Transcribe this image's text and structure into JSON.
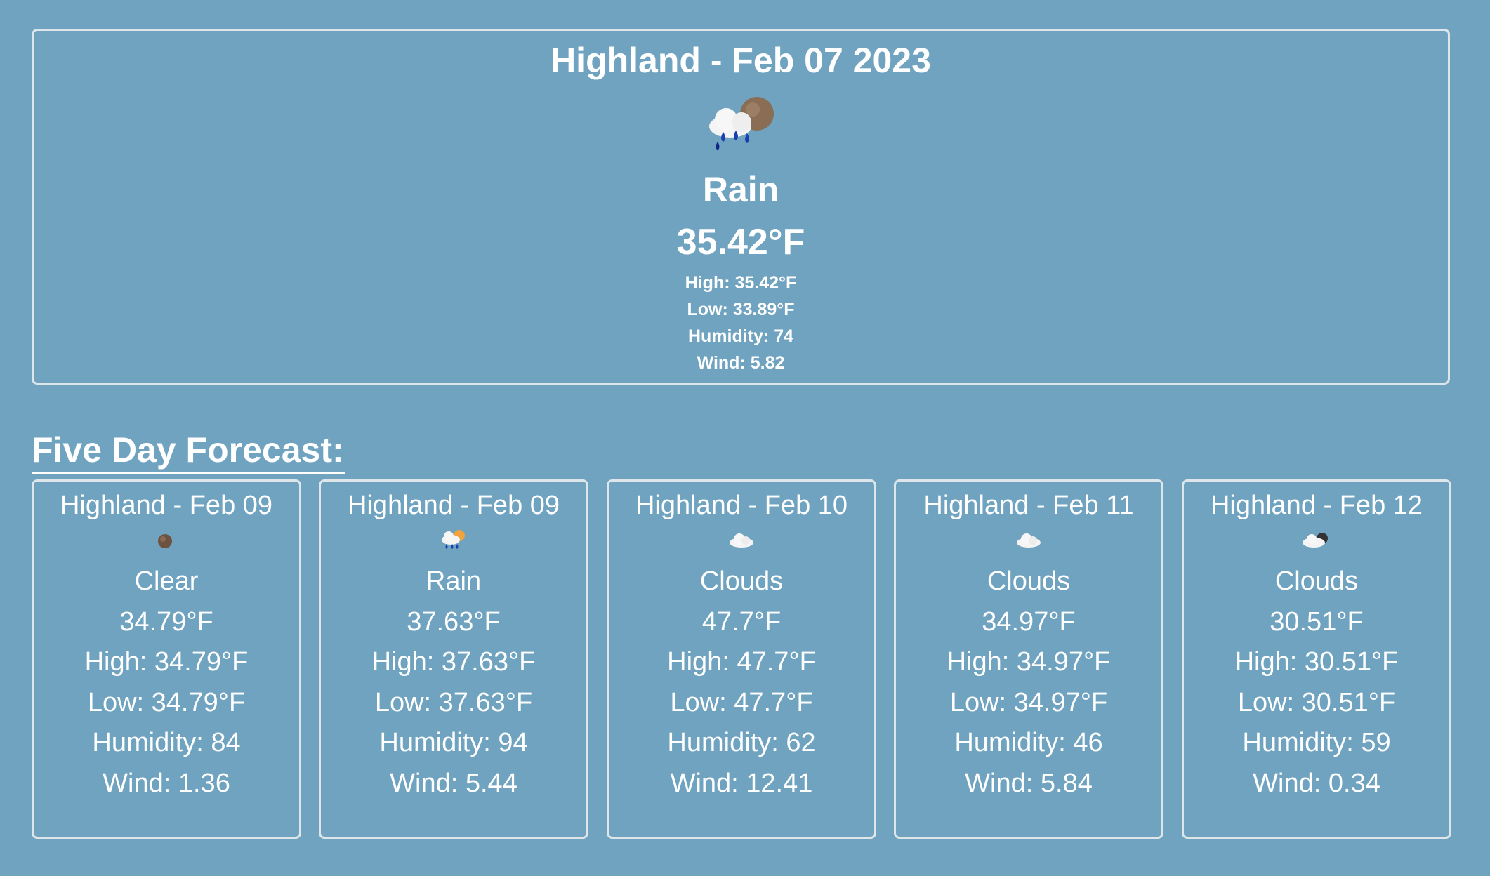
{
  "current": {
    "title": "Highland - Feb 07 2023",
    "icon": "rain-sun-icon",
    "condition": "Rain",
    "temp": "35.42°F",
    "high": "High: 35.42°F",
    "low": "Low: 33.89°F",
    "humidity": "Humidity: 74",
    "wind": "Wind: 5.82"
  },
  "forecast": {
    "heading": "Five Day Forecast:",
    "days": [
      {
        "title": "Highland - Feb 09",
        "icon": "clear-night-icon",
        "condition": "Clear",
        "temp": "34.79°F",
        "high": "High: 34.79°F",
        "low": "Low: 34.79°F",
        "humidity": "Humidity: 84",
        "wind": "Wind: 1.36"
      },
      {
        "title": "Highland - Feb 09",
        "icon": "rain-sun-icon",
        "condition": "Rain",
        "temp": "37.63°F",
        "high": "High: 37.63°F",
        "low": "Low: 37.63°F",
        "humidity": "Humidity: 94",
        "wind": "Wind: 5.44"
      },
      {
        "title": "Highland - Feb 10",
        "icon": "cloud-icon",
        "condition": "Clouds",
        "temp": "47.7°F",
        "high": "High: 47.7°F",
        "low": "Low: 47.7°F",
        "humidity": "Humidity: 62",
        "wind": "Wind: 12.41"
      },
      {
        "title": "Highland - Feb 11",
        "icon": "cloud-icon",
        "condition": "Clouds",
        "temp": "34.97°F",
        "high": "High: 34.97°F",
        "low": "Low: 34.97°F",
        "humidity": "Humidity: 46",
        "wind": "Wind: 5.84"
      },
      {
        "title": "Highland - Feb 12",
        "icon": "cloud-night-icon",
        "condition": "Clouds",
        "temp": "30.51°F",
        "high": "High: 30.51°F",
        "low": "Low: 30.51°F",
        "humidity": "Humidity: 59",
        "wind": "Wind: 0.34"
      }
    ]
  },
  "colors": {
    "background": "#6fa3c0",
    "border": "#dfe6ea",
    "text": "#ffffff"
  }
}
